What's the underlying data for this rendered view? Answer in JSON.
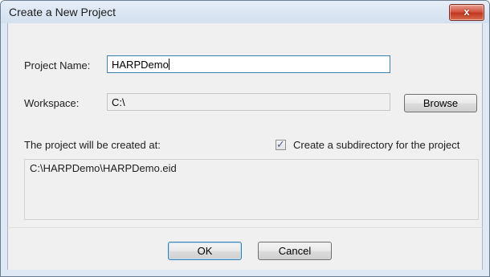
{
  "window": {
    "title": "Create a New Project",
    "close_glyph": "x"
  },
  "form": {
    "project_name_label": "Project Name:",
    "project_name_value": "HARPDemo",
    "workspace_label": "Workspace:",
    "workspace_value": "C:\\",
    "browse_label": "Browse",
    "created_at_label": "The project will be created at:",
    "subdirectory_label": "Create a subdirectory for the project",
    "subdirectory_checked": true,
    "project_path": "C:\\HARPDemo\\HARPDemo.eid"
  },
  "buttons": {
    "ok_label": "OK",
    "cancel_label": "Cancel"
  },
  "colors": {
    "frame": "#dfe9f5",
    "client": "#f0f0f0",
    "close_red": "#c0371f",
    "focus_blue": "#3c7fb1"
  },
  "icons": {
    "close": "close-icon",
    "checkbox_mark": "checkmark-icon"
  }
}
